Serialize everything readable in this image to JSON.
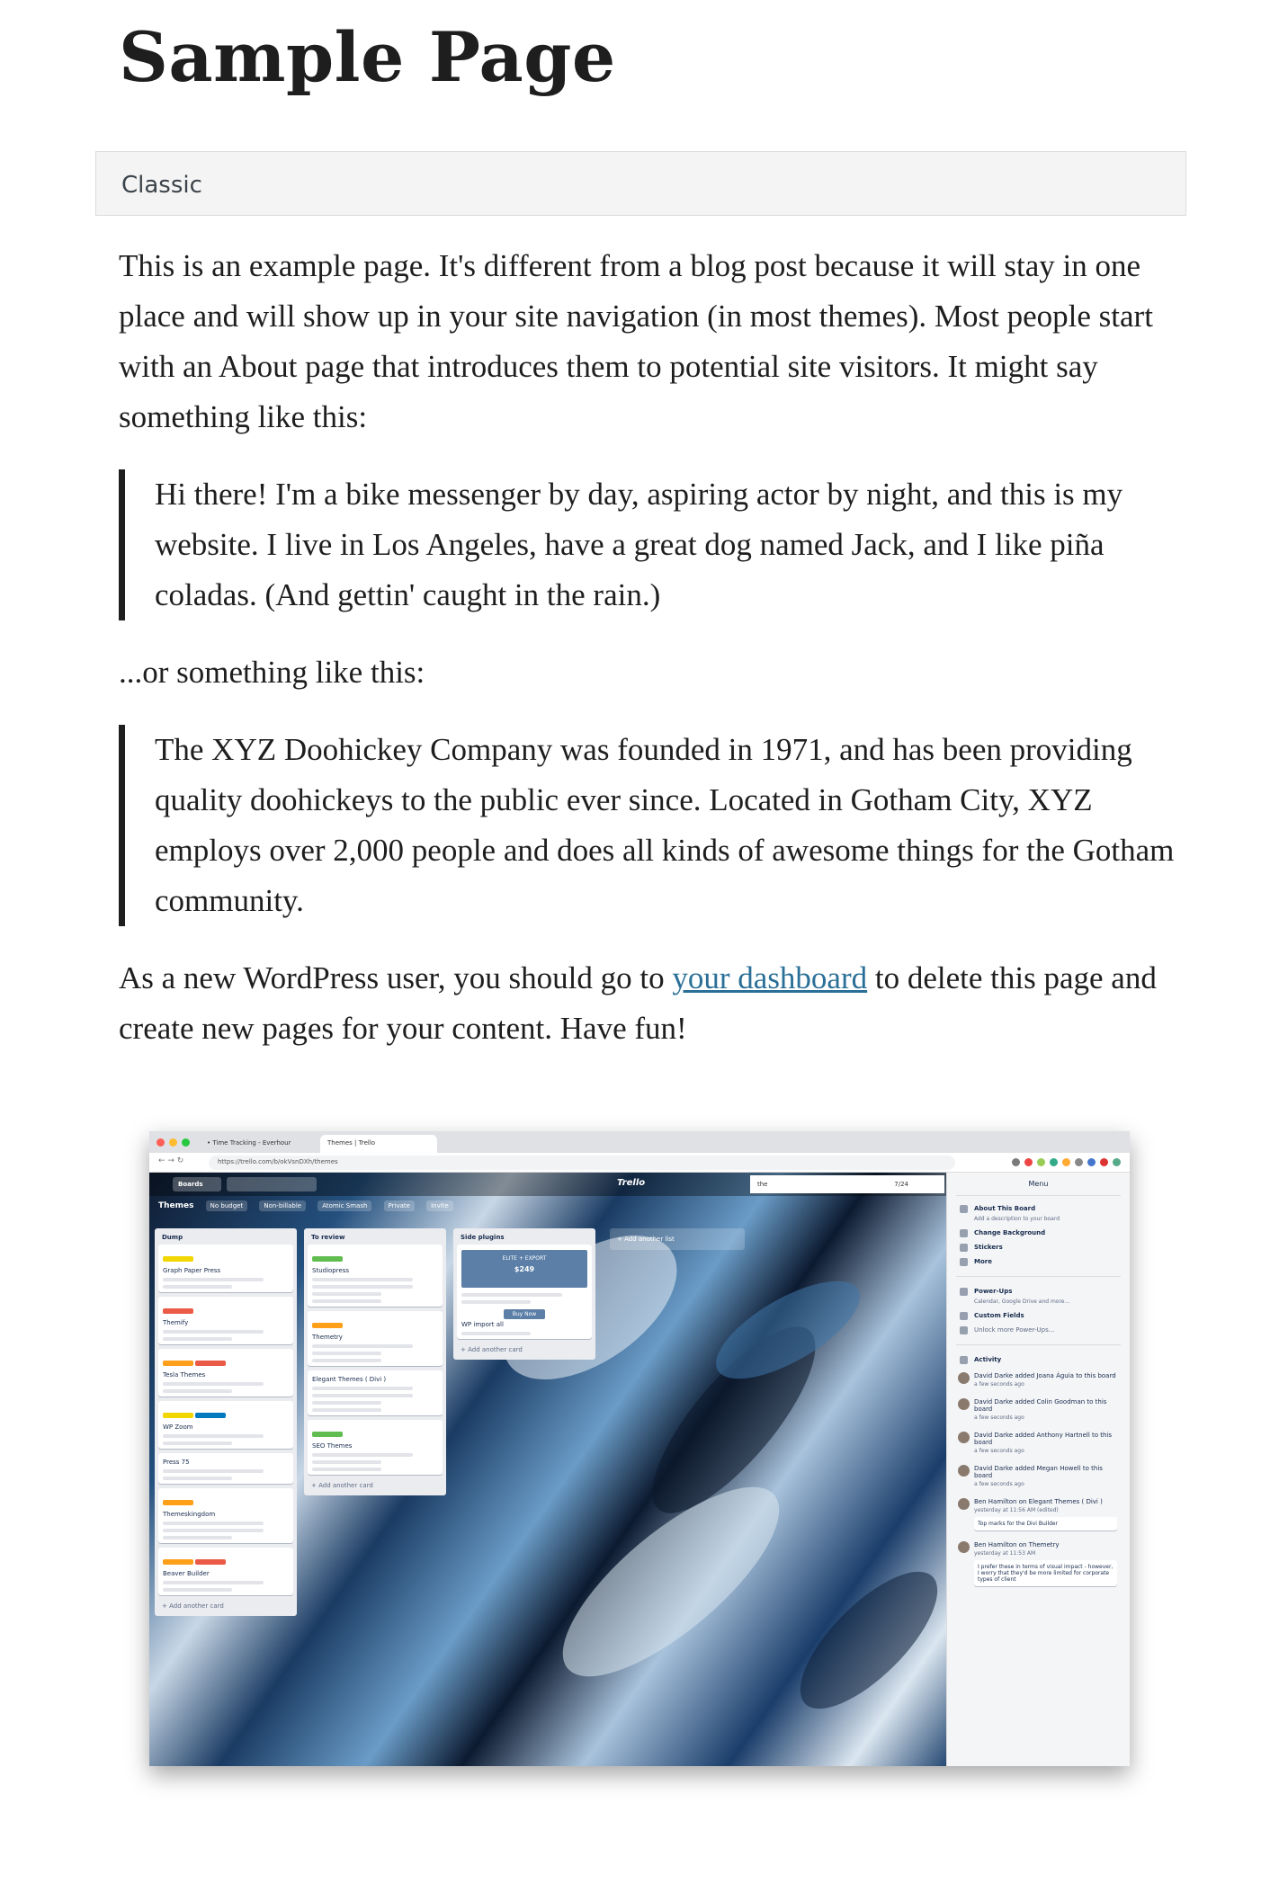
{
  "page": {
    "title": "Sample Page",
    "block_label": "Classic",
    "intro": "This is an example page. It's different from a blog post because it will stay in one place and will show up in your site navigation (in most themes). Most people start with an About page that introduces them to potential site visitors. It might say something like this:",
    "quote1": "Hi there! I'm a bike messenger by day, aspiring actor by night, and this is my website. I live in Los Angeles, have a great dog named Jack, and I like piña coladas. (And gettin' caught in the rain.)",
    "or_text": "...or something like this:",
    "quote2": "The XYZ Doohickey Company was founded in 1971, and has been providing quality doohickeys to the public ever since. Located in Gotham City, XYZ employs over 2,000 people and does all kinds of awesome things for the Gotham community.",
    "closing_before": "As a new WordPress user, you should go to ",
    "closing_link": "your dashboard",
    "closing_after": " to delete this page and create new pages for your content. Have fun!"
  },
  "screenshot": {
    "tabs": [
      "• Time Tracking - Everhour",
      "Themes | Trello"
    ],
    "url": "https://trello.com/b/okVsnDXh/themes",
    "board_title": "Themes",
    "board_badges": [
      "No budget",
      "Non-billable",
      "Atomic Smash",
      "Private",
      "Invite"
    ],
    "boards_label": "Boards",
    "logo": "Trello",
    "find_text": "the",
    "find_count": "7/24",
    "add_list": "+ Add another list",
    "add_card": "+ Add another card",
    "lists": [
      {
        "name": "Dump",
        "cards": [
          "Graph Paper Press",
          "Themify",
          "Tesla Themes",
          "WP Zoom",
          "Press 75",
          "Themeskingdom",
          "Beaver Builder"
        ]
      },
      {
        "name": "To review",
        "cards": [
          "Studiopress",
          "Themetry",
          "Elegant Themes ( Divi )",
          "SEO Themes"
        ]
      },
      {
        "name": "Side plugins",
        "cards": [
          "WP import all"
        ]
      }
    ],
    "promo": {
      "title": "ELITE + EXPORT",
      "price": "$249",
      "button": "Buy Now"
    },
    "menu": {
      "title": "Menu",
      "items": [
        {
          "label": "About This Board",
          "sub": "Add a description to your board"
        },
        {
          "label": "Change Background",
          "sub": ""
        },
        {
          "label": "Stickers",
          "sub": ""
        },
        {
          "label": "More",
          "sub": ""
        },
        {
          "label": "Power-Ups",
          "sub": "Calendar, Google Drive and more..."
        },
        {
          "label": "Custom Fields",
          "sub": ""
        },
        {
          "label": "Unlock more Power-Ups...",
          "sub": ""
        }
      ],
      "activity_title": "Activity",
      "activity": [
        {
          "text": "David Darke added Joana Águia to this board",
          "time": "a few seconds ago",
          "comment": ""
        },
        {
          "text": "David Darke added Colin Goodman to this board",
          "time": "a few seconds ago",
          "comment": ""
        },
        {
          "text": "David Darke added Anthony Hartnell to this board",
          "time": "a few seconds ago",
          "comment": ""
        },
        {
          "text": "David Darke added Megan Howell to this board",
          "time": "a few seconds ago",
          "comment": ""
        },
        {
          "text": "Ben Hamilton on Elegant Themes ( Divi )",
          "time": "yesterday at 11:56 AM (edited)",
          "comment": "Top marks for the Divi Builder"
        },
        {
          "text": "Ben Hamilton on Themetry",
          "time": "yesterday at 11:53 AM",
          "comment": "I prefer these in terms of visual impact - however, I worry that they'd be more limited for corporate types of client"
        }
      ]
    }
  }
}
